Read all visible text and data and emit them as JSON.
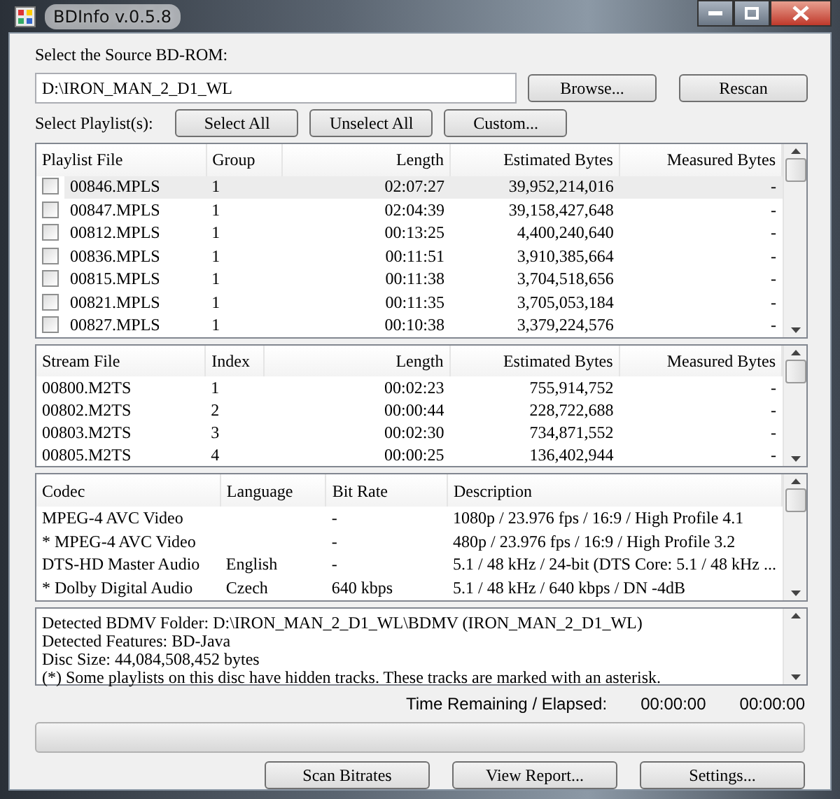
{
  "window": {
    "title": "BDInfo v.0.5.8"
  },
  "source": {
    "label": "Select the Source BD-ROM:",
    "path": "D:\\IRON_MAN_2_D1_WL",
    "buttons": [
      "Browse...",
      "Rescan"
    ]
  },
  "playlist_selection": {
    "label": "Select Playlist(s):",
    "buttons": [
      "Select All",
      "Unselect All",
      "Custom..."
    ]
  },
  "playlists": {
    "columns": [
      "Playlist File",
      "Group",
      "Length",
      "Estimated Bytes",
      "Measured Bytes"
    ],
    "rows": [
      {
        "cells": [
          "00846.MPLS",
          "1",
          "02:07:27",
          "39,952,214,016",
          "-"
        ],
        "checked": false,
        "selected": true
      },
      {
        "cells": [
          "00847.MPLS",
          "1",
          "02:04:39",
          "39,158,427,648",
          "-"
        ],
        "checked": false,
        "selected": false
      },
      {
        "cells": [
          "00812.MPLS",
          "1",
          "00:13:25",
          "4,400,240,640",
          "-"
        ],
        "checked": false,
        "selected": false
      },
      {
        "cells": [
          "00836.MPLS",
          "1",
          "00:11:51",
          "3,910,385,664",
          "-"
        ],
        "checked": false,
        "selected": false
      },
      {
        "cells": [
          "00815.MPLS",
          "1",
          "00:11:38",
          "3,704,518,656",
          "-"
        ],
        "checked": false,
        "selected": false
      },
      {
        "cells": [
          "00821.MPLS",
          "1",
          "00:11:35",
          "3,705,053,184",
          "-"
        ],
        "checked": false,
        "selected": false
      },
      {
        "cells": [
          "00827.MPLS",
          "1",
          "00:10:38",
          "3,379,224,576",
          "-"
        ],
        "checked": false,
        "selected": false
      }
    ]
  },
  "streams": {
    "columns": [
      "Stream File",
      "Index",
      "Length",
      "Estimated Bytes",
      "Measured Bytes"
    ],
    "rows": [
      {
        "cells": [
          "00800.M2TS",
          "1",
          "00:02:23",
          "755,914,752",
          "-"
        ]
      },
      {
        "cells": [
          "00802.M2TS",
          "2",
          "00:00:44",
          "228,722,688",
          "-"
        ]
      },
      {
        "cells": [
          "00803.M2TS",
          "3",
          "00:02:30",
          "734,871,552",
          "-"
        ]
      },
      {
        "cells": [
          "00805.M2TS",
          "4",
          "00:00:25",
          "136,402,944",
          "-"
        ]
      }
    ]
  },
  "tracks": {
    "columns": [
      "Codec",
      "Language",
      "Bit Rate",
      "Description"
    ],
    "rows": [
      {
        "cells": [
          "MPEG-4 AVC Video",
          "",
          "-",
          "1080p / 23.976 fps / 16:9 / High Profile 4.1"
        ]
      },
      {
        "cells": [
          "* MPEG-4 AVC Video",
          "",
          "-",
          "480p / 23.976 fps / 16:9 / High Profile 3.2"
        ]
      },
      {
        "cells": [
          "DTS-HD Master Audio",
          "English",
          "-",
          "5.1 / 48 kHz / 24-bit (DTS Core: 5.1 / 48 kHz ..."
        ]
      },
      {
        "cells": [
          "* Dolby Digital Audio",
          "Czech",
          "640 kbps",
          "5.1 / 48 kHz / 640 kbps / DN -4dB"
        ]
      }
    ]
  },
  "info_lines": [
    "Detected BDMV Folder: D:\\IRON_MAN_2_D1_WL\\BDMV (IRON_MAN_2_D1_WL)",
    "Detected Features: BD-Java",
    "Disc Size: 44,084,508,452 bytes",
    "(*) Some playlists on this disc have hidden tracks. These tracks are marked with an asterisk."
  ],
  "progress": {
    "label": "Time Remaining / Elapsed:",
    "remaining": "00:00:00",
    "elapsed": "00:00:00",
    "level": 0
  },
  "buttons": [
    "Scan Bitrates",
    "View Report...",
    "Settings..."
  ]
}
